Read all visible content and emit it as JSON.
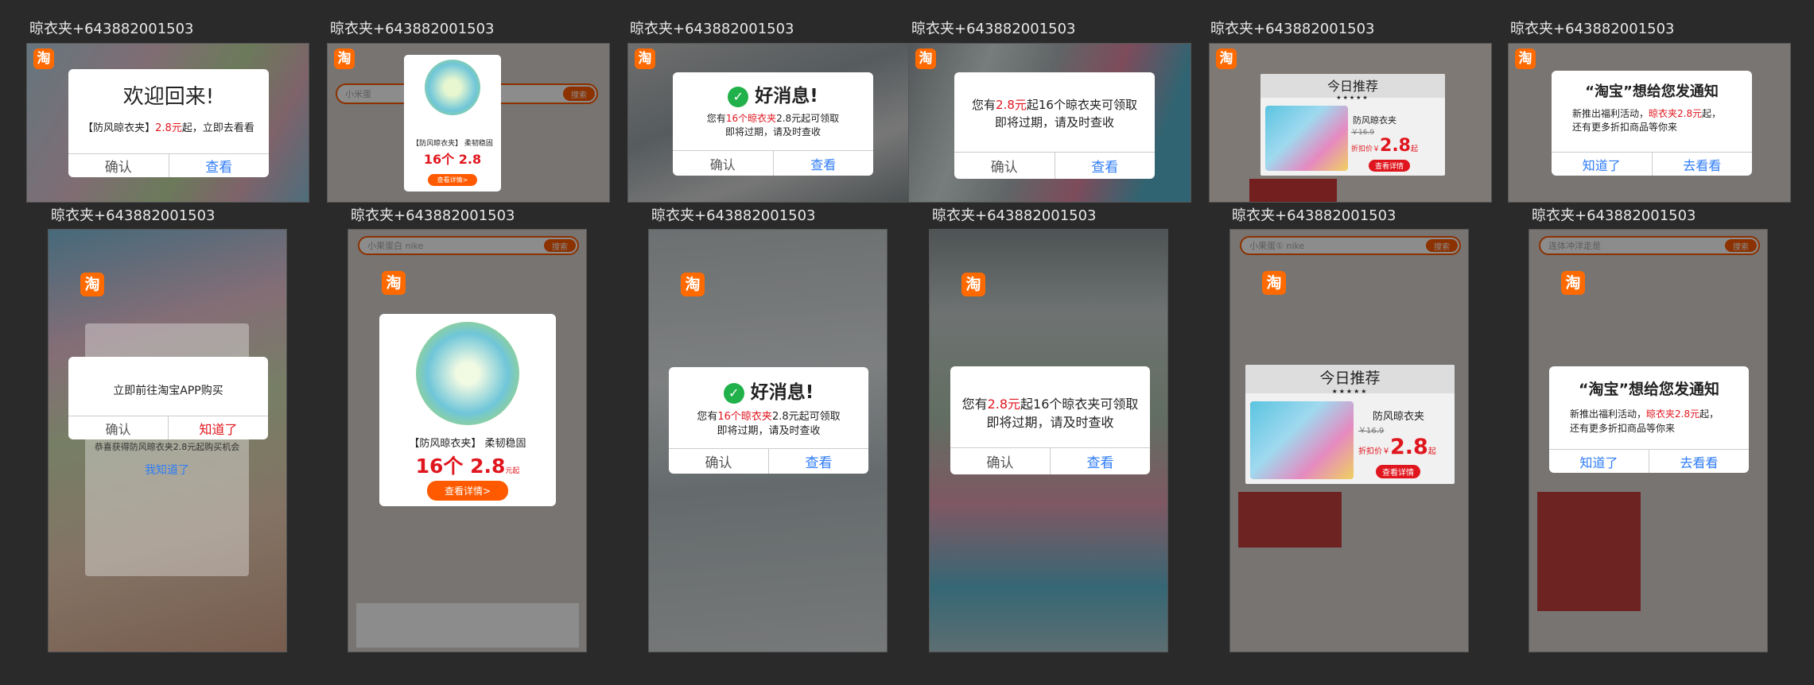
{
  "label": "晾衣夹+643882001503",
  "logo_char": "淘",
  "texts": {
    "welcome_title": "欢迎回来!",
    "welcome_body_pre": "【防风晾衣夹】",
    "welcome_body_price": "2.8元",
    "welcome_body_post": "起，立即去看看",
    "confirm": "确认",
    "view": "查看",
    "product_caption_1": "【防风晾衣夹】 柔韧稳固",
    "count_16": "16个",
    "price_28": "2.8",
    "price_unit": "元起",
    "view_detail": "查看详情>",
    "good_news": "好消息!",
    "good_news_line1_pre": "您有",
    "good_news_line1_red": "16个晾衣夹",
    "good_news_line1_post": "2.8元起可领取",
    "good_news_line2": "即将过期，请及时查收",
    "expire_line1_pre": "您有",
    "expire_line1_red": "2.8元",
    "expire_line1_post": "起16个晾衣夹可领取",
    "expire_line2": "即将过期，请及时查收",
    "rec_title": "今日推荐",
    "rec_stars": "★★★★★",
    "rec_product": "防风晾衣夹",
    "rec_old_price": "￥16.9",
    "rec_discount_label": "折扣价￥",
    "rec_price": "2.8",
    "rec_price_unit": "起",
    "rec_button": "查看详情",
    "notify_title": "“淘宝”想给您发通知",
    "notify_line1_pre": "新推出福利活动，",
    "notify_line1_red": "晾衣夹2.8元",
    "notify_line1_post": "起，",
    "notify_line2": "还有更多折扣商品等你来",
    "know": "知道了",
    "go_look": "去看看",
    "goto_app": "立即前往淘宝APP购买",
    "know_red": "知道了",
    "bg_promo": "恭喜获得防风晾衣夹2.8元起购买机会",
    "bg_know": "我知道了"
  },
  "colors": {
    "red": "#e0161e",
    "blue": "#2f7cf6",
    "orange": "#ff5a00",
    "green": "#21b14b"
  }
}
